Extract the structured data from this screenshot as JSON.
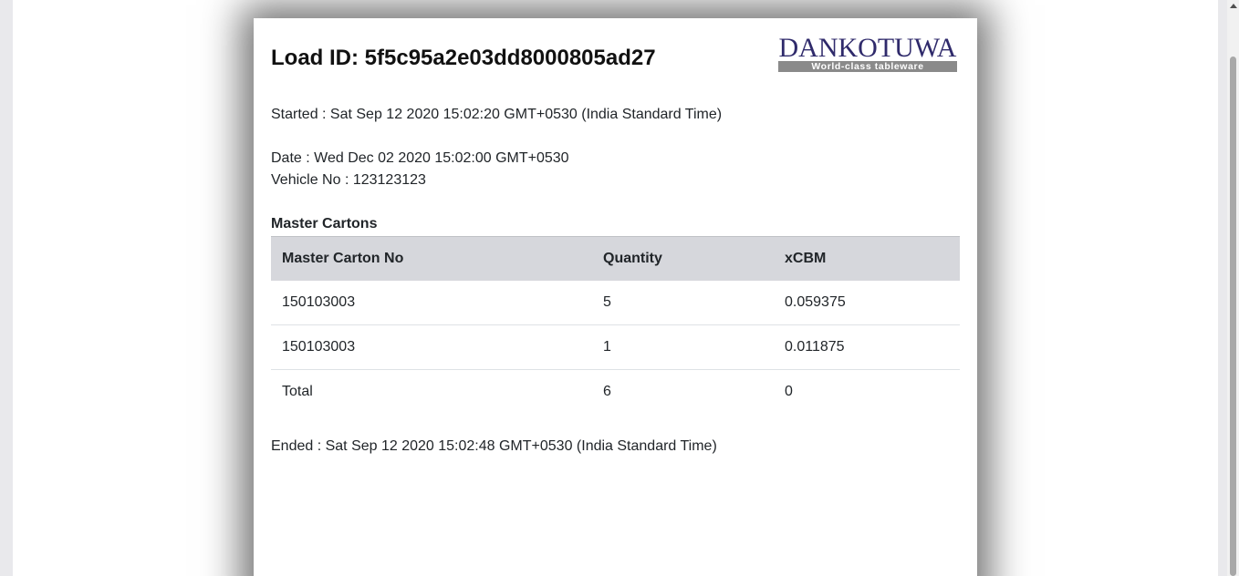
{
  "load": {
    "title": "Load ID: 5f5c95a2e03dd8000805ad27",
    "started": "Started : Sat Sep 12 2020 15:02:20 GMT+0530 (India Standard Time)",
    "date": "Date : Wed Dec 02 2020 15:02:00 GMT+0530",
    "vehicle": "Vehicle No : 123123123",
    "ended": "Ended : Sat Sep 12 2020 15:02:48 GMT+0530 (India Standard Time)"
  },
  "logo": {
    "word": "DANKOTUWA",
    "tagline": "World-class tableware",
    "colors": {
      "word": "#2f2a6b",
      "tag_bg": "#8a8a8a"
    }
  },
  "master_cartons": {
    "label": "Master Cartons",
    "columns": [
      "Master Carton No",
      "Quantity",
      "xCBM"
    ],
    "rows": [
      [
        "150103003",
        "5",
        "0.059375"
      ],
      [
        "150103003",
        "1",
        "0.011875"
      ]
    ],
    "total": [
      "Total",
      "6",
      "0"
    ]
  }
}
